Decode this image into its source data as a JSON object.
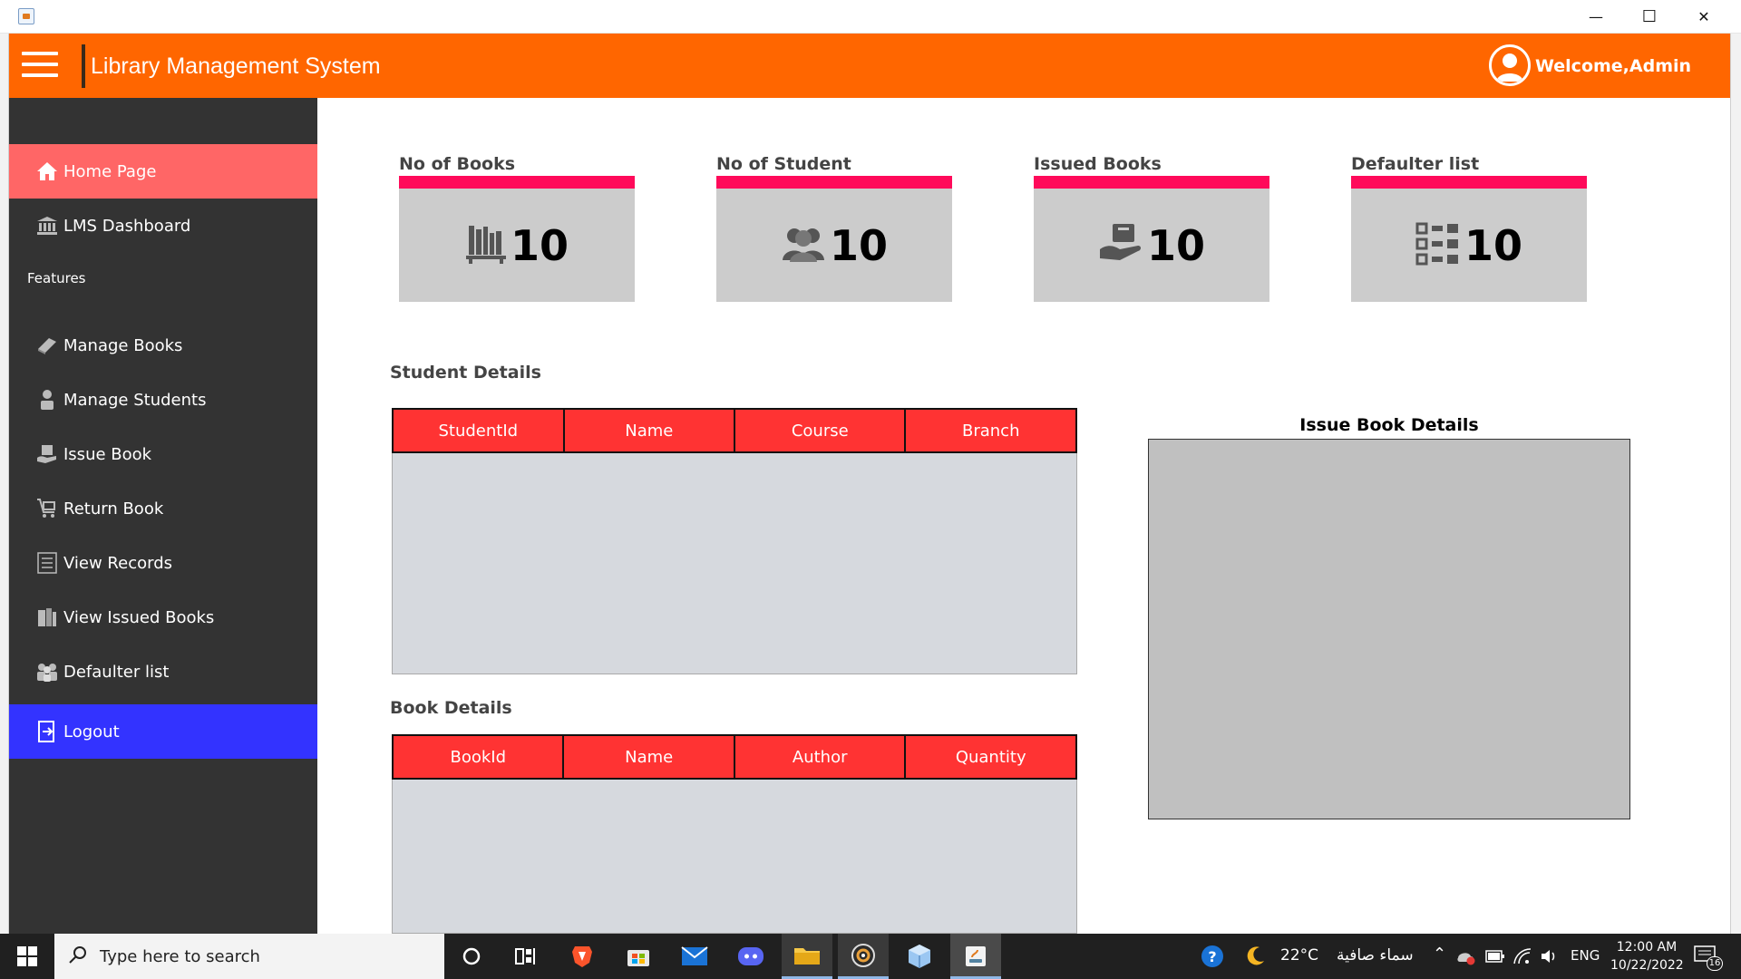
{
  "window": {
    "minimize_glyph": "—",
    "maximize_glyph": "☐",
    "close_glyph": "✕"
  },
  "header": {
    "title": "Library Management System",
    "welcome": "Welcome,Admin",
    "bg_color": "#ff6600"
  },
  "sidebar": {
    "section_label": "Features",
    "items": [
      {
        "label": "Home Page",
        "icon": "home-icon",
        "active": true,
        "bg": "#ff6666"
      },
      {
        "label": "LMS Dashboard",
        "icon": "bank-icon"
      },
      {
        "label": "Manage Books",
        "icon": "book-icon"
      },
      {
        "label": "Manage Students",
        "icon": "student-icon"
      },
      {
        "label": "Issue Book",
        "icon": "issue-book-icon"
      },
      {
        "label": "Return Book",
        "icon": "cart-icon"
      },
      {
        "label": "View Records",
        "icon": "list-icon"
      },
      {
        "label": "View Issued Books",
        "icon": "books-icon"
      },
      {
        "label": "Defaulter list",
        "icon": "group-icon"
      },
      {
        "label": "Logout",
        "icon": "logout-icon",
        "bg": "#3333ff"
      }
    ]
  },
  "cards": [
    {
      "label": "No of Books",
      "value": "10",
      "icon": "bookshelf-icon"
    },
    {
      "label": "No of Student",
      "value": "10",
      "icon": "people-icon"
    },
    {
      "label": "Issued Books",
      "value": "10",
      "icon": "hand-book-icon"
    },
    {
      "label": "Defaulter list",
      "value": "10",
      "icon": "checklist-icon"
    }
  ],
  "student_details": {
    "title": "Student Details",
    "columns": [
      "StudentId",
      "Name",
      "Course",
      "Branch"
    ]
  },
  "book_details": {
    "title": "Book Details",
    "columns": [
      "BookId",
      "Name",
      "Author",
      "Quantity"
    ]
  },
  "issue_book_details": {
    "title": "Issue Book Details"
  },
  "taskbar": {
    "search_placeholder": "Type here to search",
    "weather_temp": "22°C",
    "weather_text": "سماء صافية",
    "language": "ENG",
    "time": "12:00 AM",
    "date": "10/22/2022",
    "notification_count": "16"
  }
}
